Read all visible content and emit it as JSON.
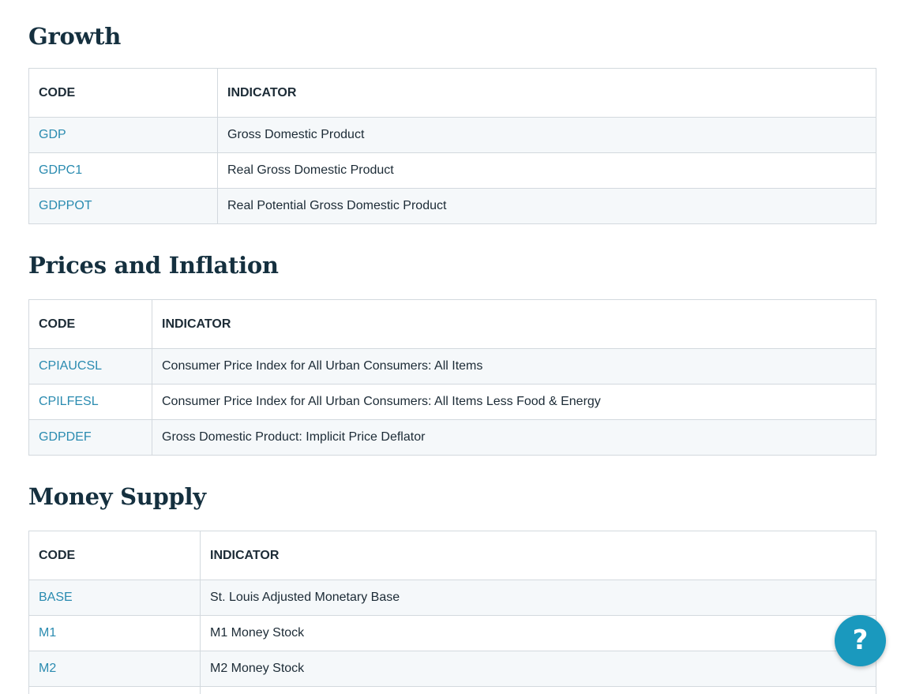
{
  "columns": {
    "code": "CODE",
    "indicator": "INDICATOR"
  },
  "sections": [
    {
      "title": "Growth",
      "rows": [
        {
          "code": "GDP",
          "indicator": "Gross Domestic Product"
        },
        {
          "code": "GDPC1",
          "indicator": "Real Gross Domestic Product"
        },
        {
          "code": "GDPPOT",
          "indicator": "Real Potential Gross Domestic Product"
        }
      ]
    },
    {
      "title": "Prices and Inflation",
      "rows": [
        {
          "code": "CPIAUCSL",
          "indicator": "Consumer Price Index for All Urban Consumers: All Items"
        },
        {
          "code": "CPILFESL",
          "indicator": "Consumer Price Index for All Urban Consumers: All Items Less Food & Energy"
        },
        {
          "code": "GDPDEF",
          "indicator": "Gross Domestic Product: Implicit Price Deflator"
        }
      ]
    },
    {
      "title": "Money Supply",
      "rows": [
        {
          "code": "BASE",
          "indicator": "St. Louis Adjusted Monetary Base"
        },
        {
          "code": "M1",
          "indicator": "M1 Money Stock"
        },
        {
          "code": "M2",
          "indicator": "M2 Money Stock"
        },
        {
          "code": "",
          "indicator": ""
        }
      ]
    }
  ],
  "help_button": {
    "label": "?"
  },
  "colors": {
    "link": "#2a8bb0",
    "heading": "#15303f",
    "help_button": "#1a99be",
    "row_stripe": "#f5f8fa",
    "border": "#d3d9de"
  }
}
